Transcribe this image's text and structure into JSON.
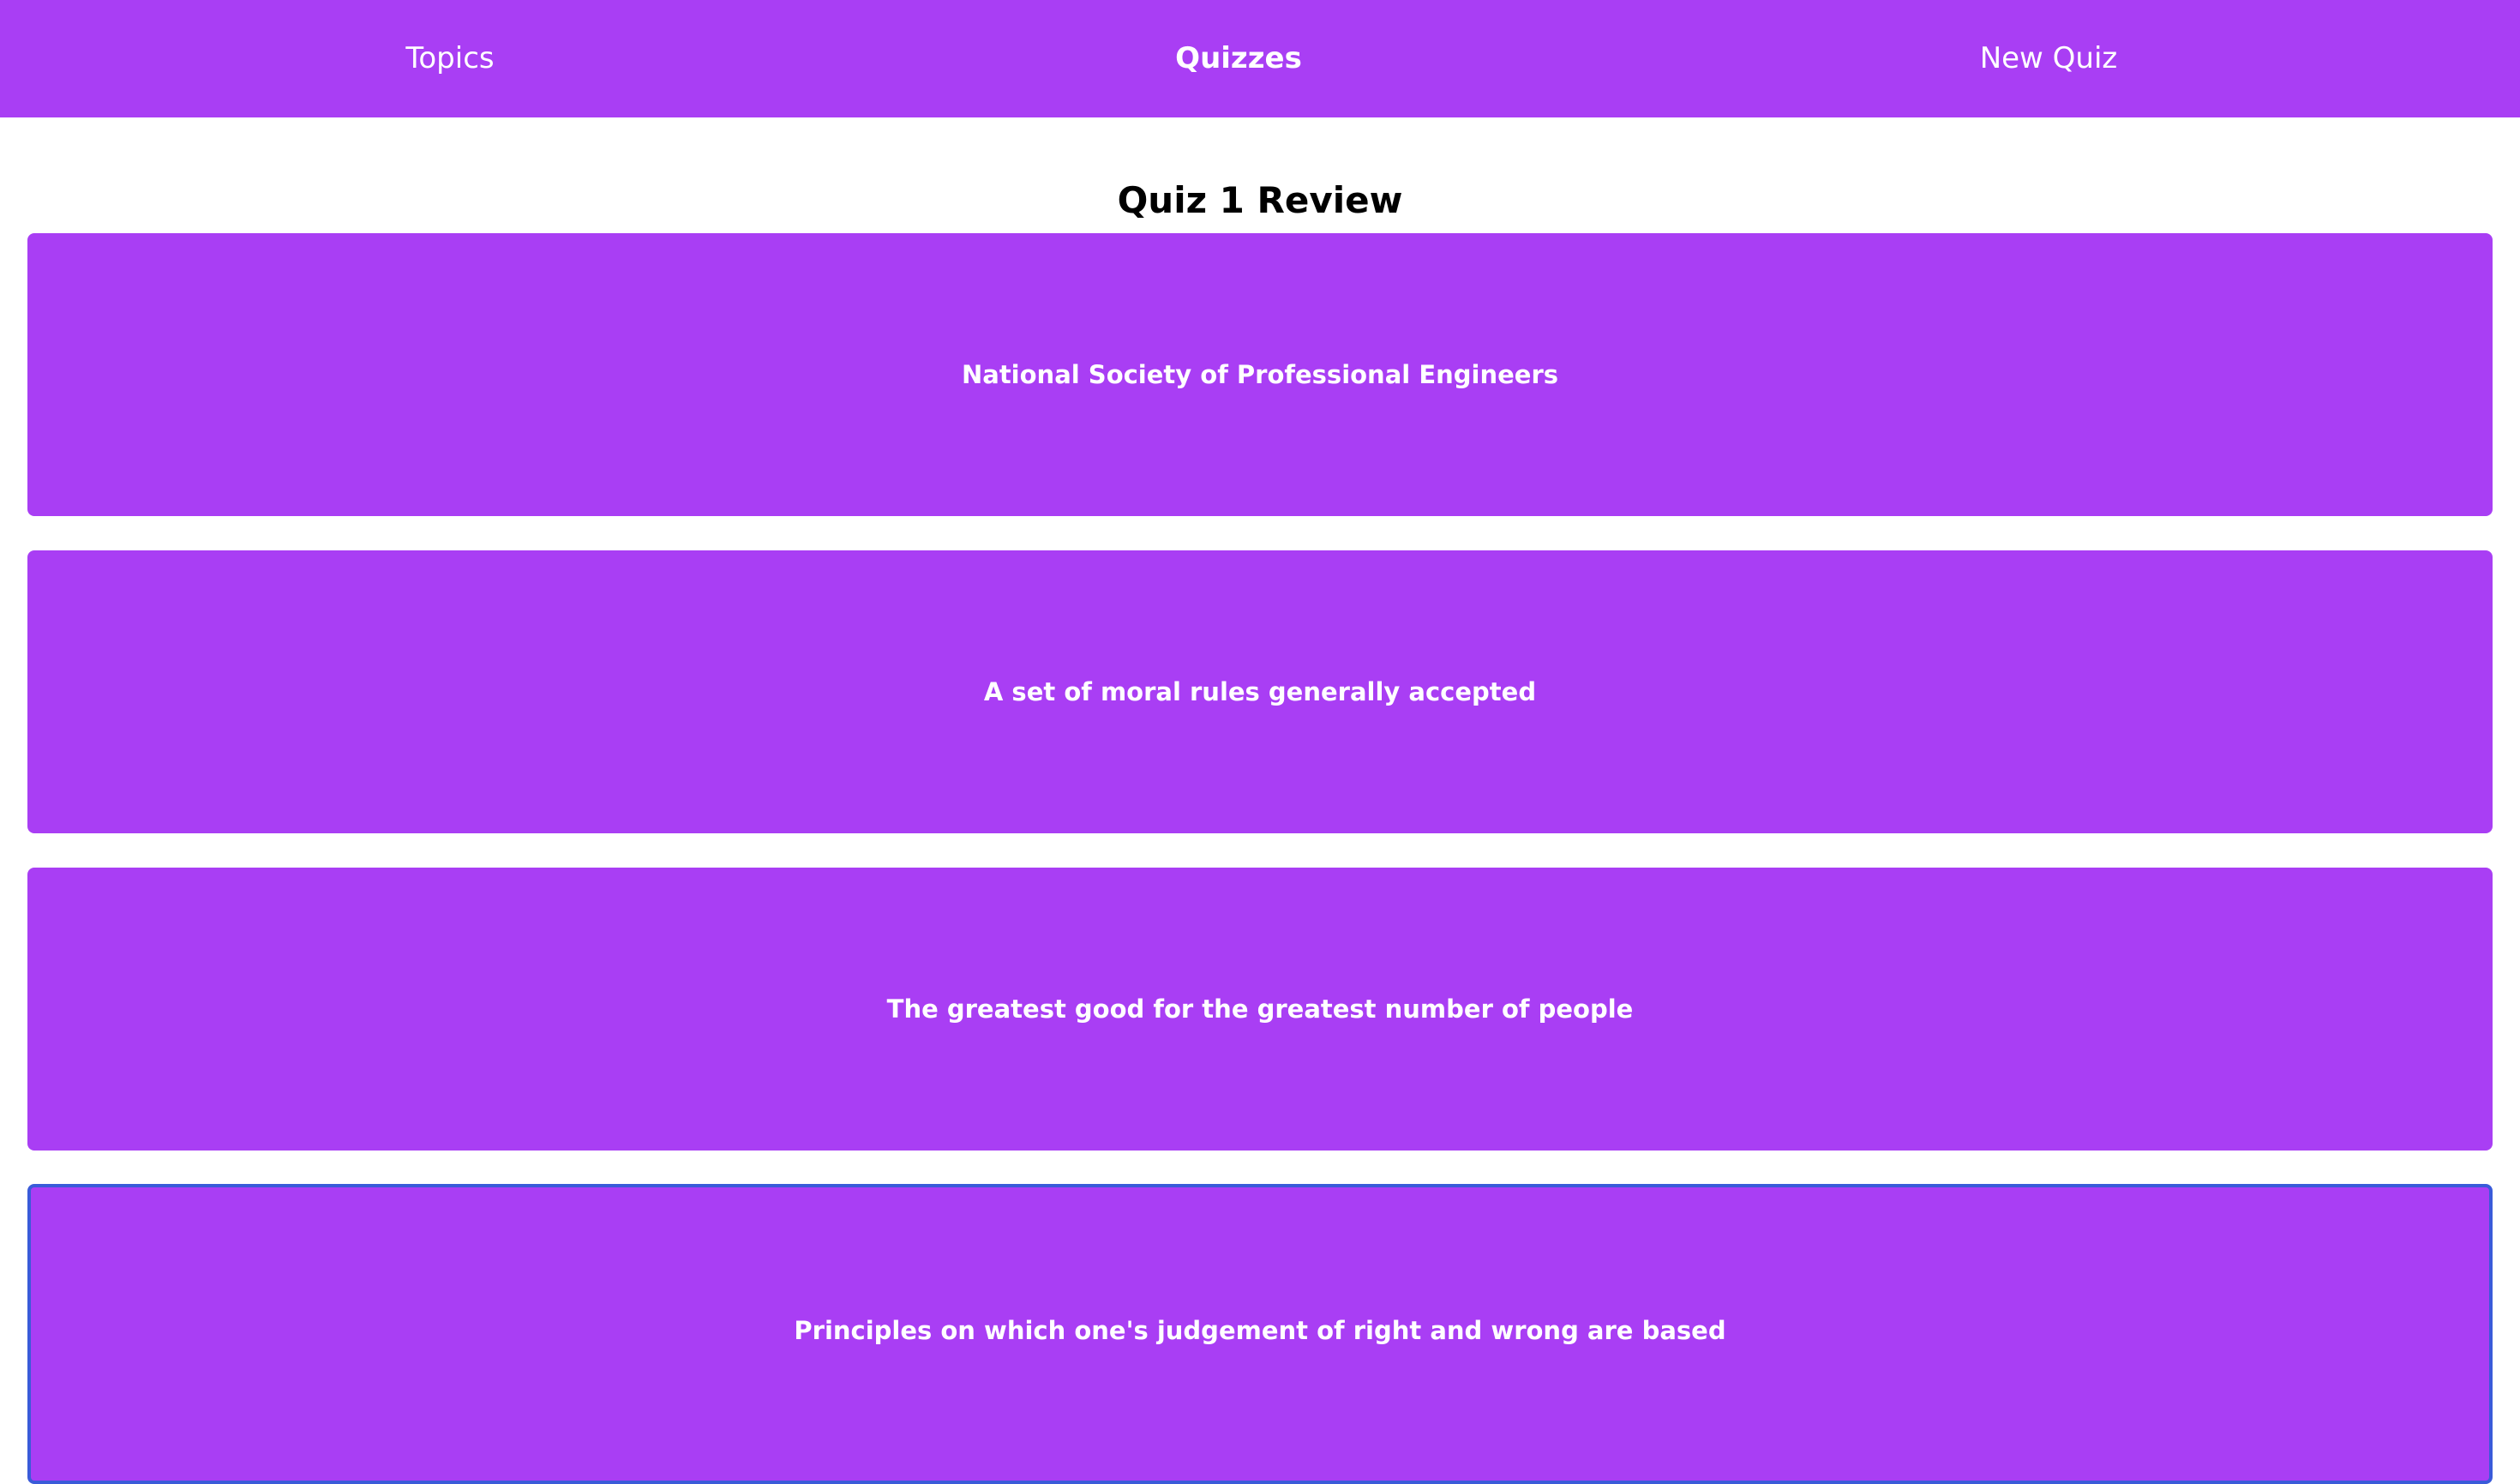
{
  "nav": {
    "items": [
      {
        "label": "Topics",
        "active": false
      },
      {
        "label": "Quizzes",
        "active": true
      },
      {
        "label": "New Quiz",
        "active": false
      }
    ]
  },
  "page": {
    "title": "Quiz 1 Review"
  },
  "cards": [
    {
      "text": "National Society of Professional Engineers"
    },
    {
      "text": "A set of moral rules generally accepted"
    },
    {
      "text": "The greatest good for the greatest number of people"
    },
    {
      "text": "Principles on which one's judgement of right and wrong are based",
      "focused": true
    }
  ],
  "colors": {
    "accent": "#a93ef4",
    "focus_border": "#3a5bd9",
    "text_on_accent": "#ffffff"
  }
}
